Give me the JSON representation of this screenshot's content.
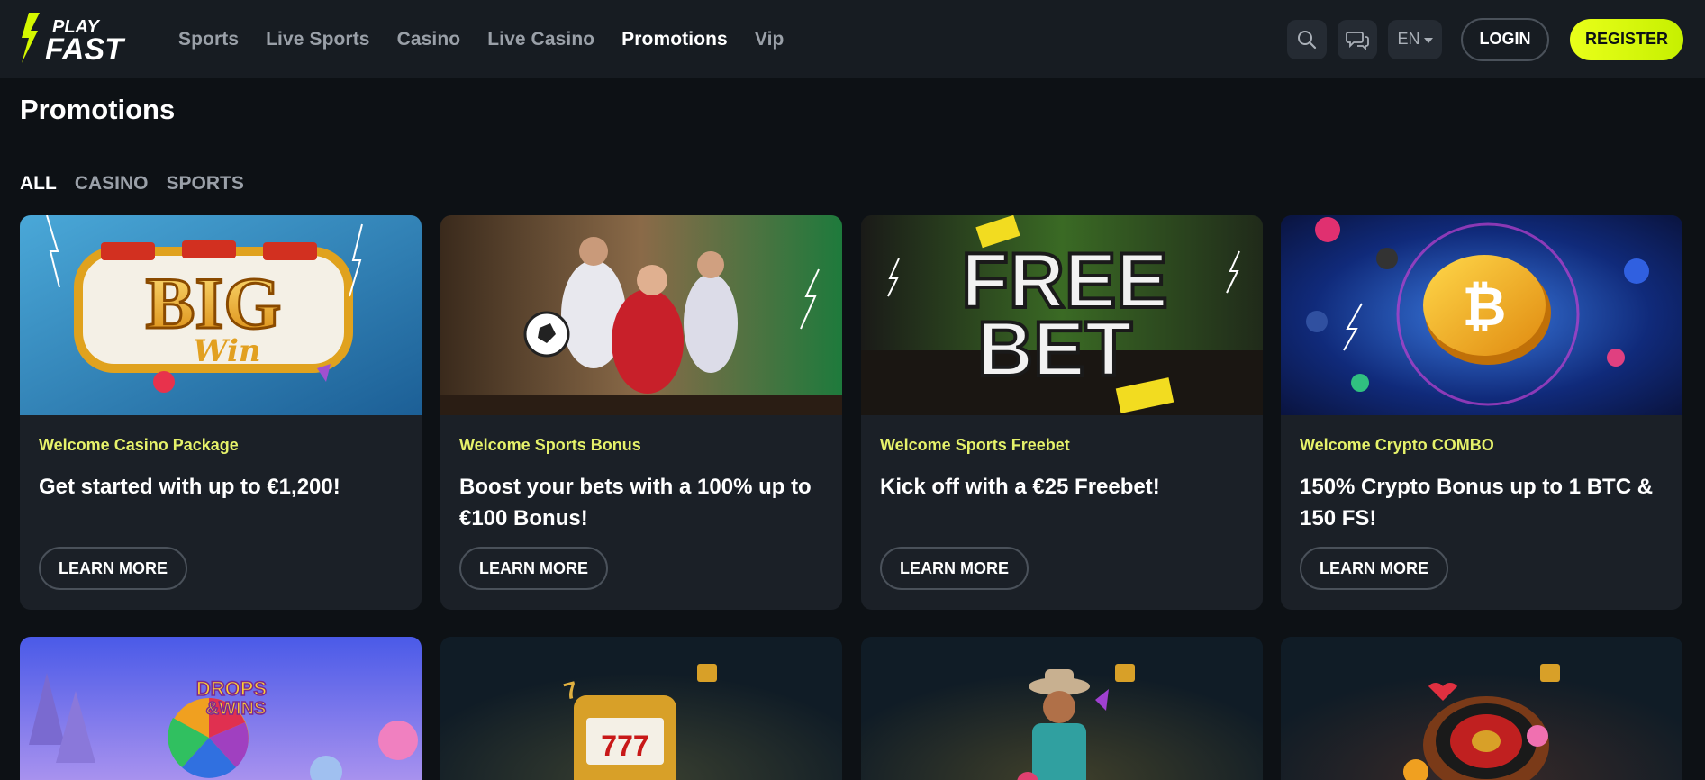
{
  "header": {
    "logo_top": "PLAY",
    "logo_bottom": "FAST",
    "nav": [
      {
        "label": "Sports",
        "active": false
      },
      {
        "label": "Live Sports",
        "active": false
      },
      {
        "label": "Casino",
        "active": false
      },
      {
        "label": "Live Casino",
        "active": false
      },
      {
        "label": "Promotions",
        "active": true
      },
      {
        "label": "Vip",
        "active": false
      }
    ],
    "icons": [
      "search-icon",
      "chat-icon"
    ],
    "language": "EN",
    "login_label": "LOGIN",
    "register_label": "REGISTER"
  },
  "page": {
    "title": "Promotions",
    "tabs": [
      {
        "label": "ALL",
        "active": true
      },
      {
        "label": "CASINO",
        "active": false
      },
      {
        "label": "SPORTS",
        "active": false
      }
    ]
  },
  "promotions": [
    {
      "tag": "Welcome Casino Package",
      "headline": "Get started with up to €1,200!",
      "button": "LEARN MORE",
      "image_text": "BIG",
      "image_subtext": "Win"
    },
    {
      "tag": "Welcome Sports Bonus",
      "headline": "Boost your bets with a 100% up to €100 Bonus!",
      "button": "LEARN MORE"
    },
    {
      "tag": "Welcome Sports Freebet",
      "headline": "Kick off with a €25 Freebet!",
      "button": "LEARN MORE",
      "image_text": "FREE",
      "image_subtext": "BET"
    },
    {
      "tag": "Welcome Crypto COMBO",
      "headline": "150% Crypto Bonus up to 1 BTC & 150 FS!",
      "button": "LEARN MORE"
    }
  ],
  "promotions_row2": [
    {
      "image_text": "DROPS",
      "image_subtext": "&WINS"
    },
    {
      "image_text": "777"
    },
    {},
    {}
  ],
  "colors": {
    "accent": "#e6f26a",
    "register": "#d4f700",
    "background": "#0d1115",
    "card": "#1b2027",
    "header": "#171c22"
  }
}
